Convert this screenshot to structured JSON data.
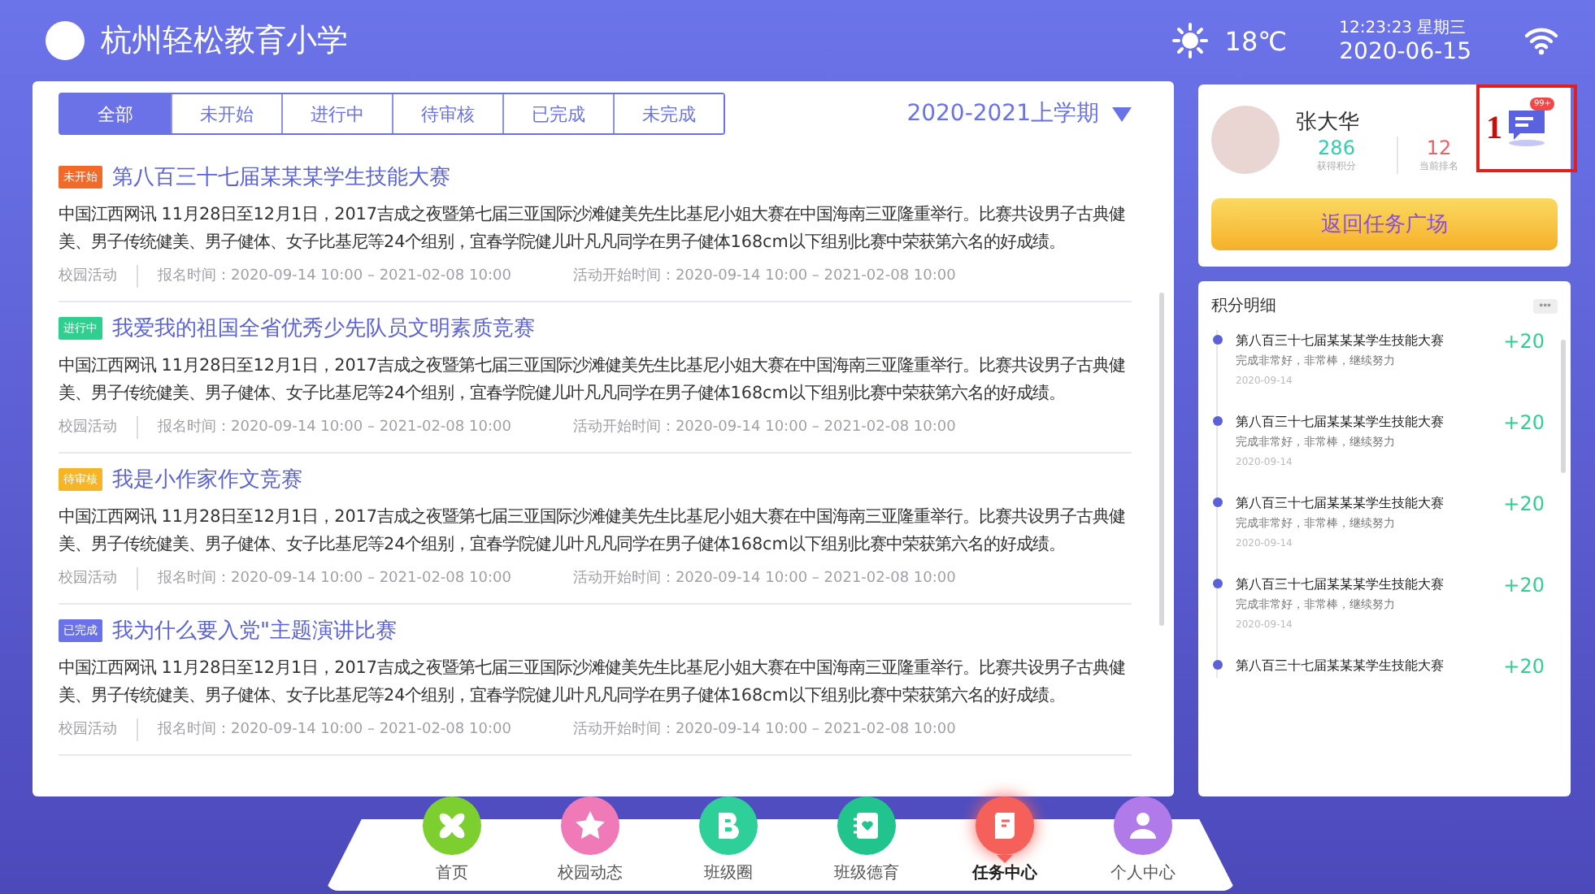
{
  "header": {
    "school": "杭州轻松教育小学",
    "temperature": "18℃",
    "time": "12:23:23 星期三",
    "date": "2020-06-15"
  },
  "task_panel": {
    "tabs": [
      {
        "label": "全部",
        "selected": true
      },
      {
        "label": "未开始",
        "selected": false
      },
      {
        "label": "进行中",
        "selected": false
      },
      {
        "label": "待审核",
        "selected": false
      },
      {
        "label": "已完成",
        "selected": false
      },
      {
        "label": "未完成",
        "selected": false
      }
    ],
    "semester": "2020-2021上学期",
    "tasks": [
      {
        "status": "未开始",
        "color": "#f06a2a",
        "title": "第八百三十七届某某某学生技能大赛",
        "description": "中国江西网讯 11月28日至12月1日，2017吉成之夜暨第七届三亚国际沙滩健美先生比基尼小姐大赛在中国海南三亚隆重举行。比赛共设男子古典健美、男子传统健美、男子健体、女子比基尼等24个组别，宜春学院健儿叶凡凡同学在男子健体168cm以下组别比赛中荣获第六名的好成绩。",
        "category": "校园活动",
        "signup_time": "报名时间：2020-09-14 10:00 – 2021-02-08 10:00",
        "start_time": "活动开始时间：2020-09-14 10:00 – 2021-02-08 10:00"
      },
      {
        "status": "进行中",
        "color": "#2fcf8f",
        "title": "我爱我的祖国全省优秀少先队员文明素质竞赛",
        "description": "中国江西网讯 11月28日至12月1日，2017吉成之夜暨第七届三亚国际沙滩健美先生比基尼小姐大赛在中国海南三亚隆重举行。比赛共设男子古典健美、男子传统健美、男子健体、女子比基尼等24个组别，宜春学院健儿叶凡凡同学在男子健体168cm以下组别比赛中荣获第六名的好成绩。",
        "category": "校园活动",
        "signup_time": "报名时间：2020-09-14 10:00 – 2021-02-08 10:00",
        "start_time": "活动开始时间：2020-09-14 10:00 – 2021-02-08 10:00"
      },
      {
        "status": "待审核",
        "color": "#f5b526",
        "title": "我是小作家作文竞赛",
        "description": "中国江西网讯 11月28日至12月1日，2017吉成之夜暨第七届三亚国际沙滩健美先生比基尼小姐大赛在中国海南三亚隆重举行。比赛共设男子古典健美、男子传统健美、男子健体、女子比基尼等24个组别，宜春学院健儿叶凡凡同学在男子健体168cm以下组别比赛中荣获第六名的好成绩。",
        "category": "校园活动",
        "signup_time": "报名时间：2020-09-14 10:00 – 2021-02-08 10:00",
        "start_time": "活动开始时间：2020-09-14 10:00 – 2021-02-08 10:00"
      },
      {
        "status": "已完成",
        "color": "#6b72e8",
        "title": "我为什么要入党\"主题演讲比赛",
        "description": "中国江西网讯 11月28日至12月1日，2017吉成之夜暨第七届三亚国际沙滩健美先生比基尼小姐大赛在中国海南三亚隆重举行。比赛共设男子古典健美、男子传统健美、男子健体、女子比基尼等24个组别，宜春学院健儿叶凡凡同学在男子健体168cm以下组别比赛中荣获第六名的好成绩。",
        "category": "校园活动",
        "signup_time": "报名时间：2020-09-14 10:00 – 2021-02-08 10:00",
        "start_time": "活动开始时间：2020-09-14 10:00 – 2021-02-08 10:00"
      }
    ]
  },
  "profile": {
    "name": "张大华",
    "points": "286",
    "points_label": "获得积分",
    "rank": "12",
    "rank_label": "当前排名",
    "message_badge": "99+",
    "annotation": "1",
    "button": "返回任务广场"
  },
  "points_detail": {
    "title": "积分明细",
    "more": "•••",
    "items": [
      {
        "title": "第八百三十七届某某某学生技能大赛",
        "comment": "完成非常好，非常棒，继续努力",
        "date": "2020-09-14",
        "score": "+20"
      },
      {
        "title": "第八百三十七届某某某学生技能大赛",
        "comment": "完成非常好，非常棒，继续努力",
        "date": "2020-09-14",
        "score": "+20"
      },
      {
        "title": "第八百三十七届某某某学生技能大赛",
        "comment": "完成非常好，非常棒，继续努力",
        "date": "2020-09-14",
        "score": "+20"
      },
      {
        "title": "第八百三十七届某某某学生技能大赛",
        "comment": "完成非常好，非常棒，继续努力",
        "date": "2020-09-14",
        "score": "+20"
      },
      {
        "title": "第八百三十七届某某某学生技能大赛",
        "score": "+20"
      }
    ]
  },
  "nav": [
    {
      "label": "首页",
      "color": "#7ccf2e",
      "selected": false
    },
    {
      "label": "校园动态",
      "color": "#f07ab8",
      "selected": false
    },
    {
      "label": "班级圈",
      "color": "#2fcf9a",
      "selected": false
    },
    {
      "label": "班级德育",
      "color": "#22c48e",
      "selected": false
    },
    {
      "label": "任务中心",
      "color": "#f5605a",
      "selected": true
    },
    {
      "label": "个人中心",
      "color": "#b07ae8",
      "selected": false
    }
  ]
}
